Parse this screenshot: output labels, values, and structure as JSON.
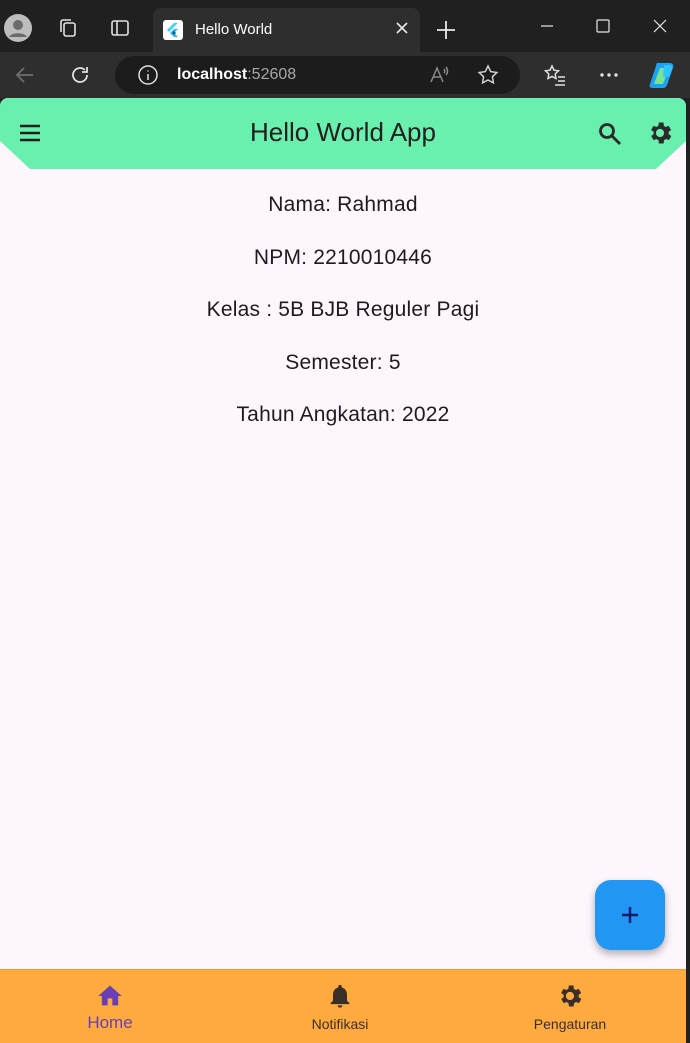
{
  "browser": {
    "tab_title": "Hello World",
    "url_host": "localhost",
    "url_port": ":52608",
    "icons": [
      "profile-icon",
      "workspaces-icon",
      "tab-actions-icon",
      "flutter-favicon",
      "close-icon",
      "new-tab-icon",
      "minimize-icon",
      "maximize-icon",
      "window-close-icon",
      "back-icon",
      "refresh-icon",
      "info-icon",
      "read-aloud-icon",
      "favorite-icon",
      "favorites-list-icon",
      "more-icon",
      "copilot-icon"
    ]
  },
  "app": {
    "title": "Hello World App",
    "colors": {
      "appbar": "#69f0ae",
      "background": "#fdf6fd",
      "fab": "#2196f3",
      "bottom_nav": "#ffaa3f",
      "active_nav": "#6a3fb3"
    },
    "profile_lines": [
      "Nama: Rahmad",
      "NPM: 2210010446",
      "Kelas : 5B BJB Reguler Pagi",
      "Semester: 5",
      "Tahun Angkatan: 2022"
    ],
    "fab_symbol": "+",
    "nav": [
      {
        "label": "Home",
        "icon": "home-icon",
        "active": true
      },
      {
        "label": "Notifikasi",
        "icon": "bell-icon",
        "active": false
      },
      {
        "label": "Pengaturan",
        "icon": "gear-icon",
        "active": false
      }
    ]
  }
}
